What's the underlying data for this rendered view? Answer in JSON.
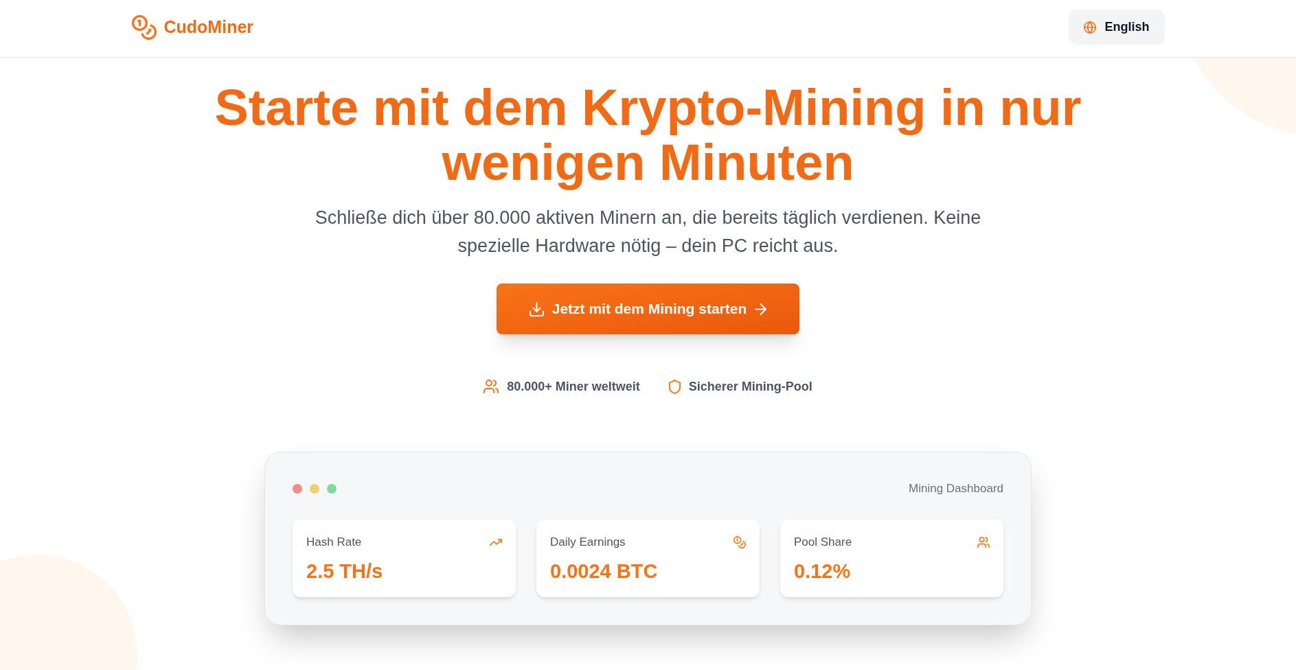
{
  "header": {
    "logo": "CudoMiner",
    "language_button": "English"
  },
  "hero": {
    "title": "Starte mit dem Krypto-Mining in nur wenigen Minuten",
    "subtitle": "Schließe dich über 80.000 aktiven Minern an, die bereits täglich verdienen. Keine spezielle Hardware nötig – dein PC reicht aus.",
    "cta_button": "Jetzt mit dem Mining starten",
    "features": [
      "80.000+ Miner weltweit",
      "Sicherer Mining-Pool"
    ]
  },
  "dashboard": {
    "window_dots": [
      {
        "color": "#f28b8b"
      },
      {
        "color": "#f2d06b"
      },
      {
        "color": "#7ddc9a"
      }
    ],
    "title": "Mining Dashboard",
    "stats": [
      {
        "label": "Hash Rate",
        "value": "2.5 TH/s"
      },
      {
        "label": "Daily Earnings",
        "value": "0.0024 BTC"
      },
      {
        "label": "Pool Share",
        "value": "0.12%"
      }
    ]
  }
}
